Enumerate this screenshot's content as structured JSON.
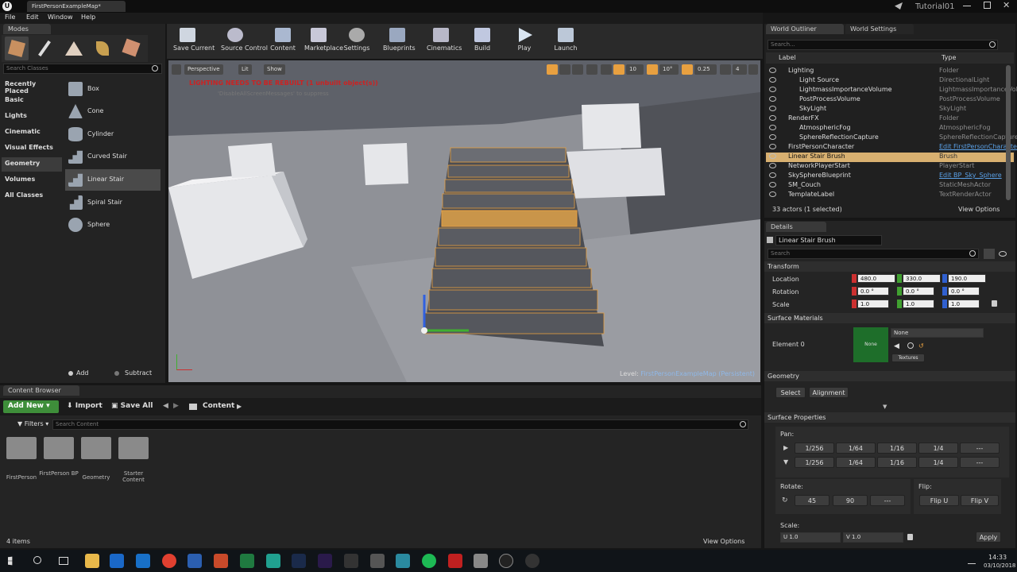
{
  "window": {
    "tab_title": "FirstPersonExampleMap*",
    "project_name": "Tutorial01"
  },
  "menu": [
    "File",
    "Edit",
    "Window",
    "Help"
  ],
  "modes": {
    "tab_label": "Modes",
    "search_placeholder": "Search Classes",
    "categories": [
      "Recently Placed",
      "Basic",
      "Lights",
      "Cinematic",
      "Visual Effects",
      "Geometry",
      "Volumes",
      "All Classes"
    ],
    "selected_category": "Geometry",
    "shapes": [
      "Box",
      "Cone",
      "Cylinder",
      "Curved Stair",
      "Linear Stair",
      "Spiral Stair",
      "Sphere"
    ],
    "selected_shape": "Linear Stair",
    "add_label": "Add",
    "subtract_label": "Subtract"
  },
  "toolbar": [
    "Save Current",
    "Source Control",
    "Content",
    "Marketplace",
    "Settings",
    "Blueprints",
    "Cinematics",
    "Build",
    "Play",
    "Launch"
  ],
  "viewport": {
    "perspective_label": "Perspective",
    "lit_label": "Lit",
    "show_label": "Show",
    "warning": "LIGHTING NEEDS TO BE REBUILT (1 unbuilt object(s))",
    "subwarning": "'DisableAllScreenMessages' to suppress",
    "grid_snap": "10",
    "rot_snap": "10°",
    "scale_snap": "0.25",
    "cam_speed": "4",
    "level_label": "Level:",
    "level_name": "FirstPersonExampleMap (Persistent)"
  },
  "outliner": {
    "tab_label": "World Outliner",
    "settings_tab": "World Settings",
    "search_placeholder": "Search...",
    "col_label": "Label",
    "col_type": "Type",
    "rows": [
      {
        "name": "Lighting",
        "type": "Folder",
        "indent": 1,
        "link": false
      },
      {
        "name": "Light Source",
        "type": "DirectionalLight",
        "indent": 2,
        "link": false
      },
      {
        "name": "LightmassImportanceVolume",
        "type": "LightmassImportanceVolume",
        "indent": 2,
        "link": false
      },
      {
        "name": "PostProcessVolume",
        "type": "PostProcessVolume",
        "indent": 2,
        "link": false
      },
      {
        "name": "SkyLight",
        "type": "SkyLight",
        "indent": 2,
        "link": false
      },
      {
        "name": "RenderFX",
        "type": "Folder",
        "indent": 1,
        "link": false
      },
      {
        "name": "AtmosphericFog",
        "type": "AtmosphericFog",
        "indent": 2,
        "link": false
      },
      {
        "name": "SphereReflectionCapture",
        "type": "SphereReflectionCapture",
        "indent": 2,
        "link": false
      },
      {
        "name": "FirstPersonCharacter",
        "type": "Edit FirstPersonCharacter",
        "indent": 1,
        "link": true
      },
      {
        "name": "Linear Stair Brush",
        "type": "Brush",
        "indent": 1,
        "link": false
      },
      {
        "name": "NetworkPlayerStart",
        "type": "PlayerStart",
        "indent": 1,
        "link": false
      },
      {
        "name": "SkySphereBlueprint",
        "type": "Edit BP_Sky_Sphere",
        "indent": 1,
        "link": true
      },
      {
        "name": "SM_Couch",
        "type": "StaticMeshActor",
        "indent": 1,
        "link": false
      },
      {
        "name": "TemplateLabel",
        "type": "TextRenderActor",
        "indent": 1,
        "link": false
      }
    ],
    "selected_row": "Linear Stair Brush",
    "status": "33 actors (1 selected)",
    "view_options": "View Options"
  },
  "details": {
    "tab_label": "Details",
    "actor_name": "Linear Stair Brush",
    "search_placeholder": "Search",
    "transform_label": "Transform",
    "location_label": "Location",
    "rotation_label": "Rotation",
    "scale_label": "Scale",
    "location": [
      "480.0",
      "330.0",
      "190.0"
    ],
    "rotation": [
      "0.0 °",
      "0.0 °",
      "0.0 °"
    ],
    "scale": [
      "1.0",
      "1.0",
      "1.0"
    ],
    "surface_materials_label": "Surface Materials",
    "element_label": "Element 0",
    "material_none": "None",
    "material_thumb": "None",
    "textures_label": "Textures",
    "geometry_label": "Geometry",
    "select_label": "Select",
    "alignment_label": "Alignment",
    "surface_props_label": "Surface Properties",
    "pan_label": "Pan:",
    "pan_values": [
      "1/256",
      "1/64",
      "1/16",
      "1/4"
    ],
    "dashes": "---",
    "rotate_label": "Rotate:",
    "rotate_values": [
      "45",
      "90"
    ],
    "flip_label": "Flip:",
    "flip_u": "Flip U",
    "flip_v": "Flip V",
    "scale2_label": "Scale:",
    "scale_u": "U  1.0",
    "scale_v": "V  1.0",
    "apply_label": "Apply"
  },
  "content_browser": {
    "tab_label": "Content Browser",
    "add_new": "Add New",
    "import": "Import",
    "save_all": "Save All",
    "path": "Content",
    "filters": "Filters",
    "search_placeholder": "Search Content",
    "folders": [
      "FirstPerson",
      "FirstPerson BP",
      "Geometry",
      "Starter Content"
    ],
    "item_count": "4 items",
    "view_options": "View Options"
  },
  "taskbar": {
    "time": "14:33",
    "date": "03/10/2018"
  },
  "colors": {
    "accent_orange": "#e8a040",
    "selection_row": "#d8b070",
    "add_new_green": "#3e8e3a",
    "warning_red": "#cc2222"
  }
}
